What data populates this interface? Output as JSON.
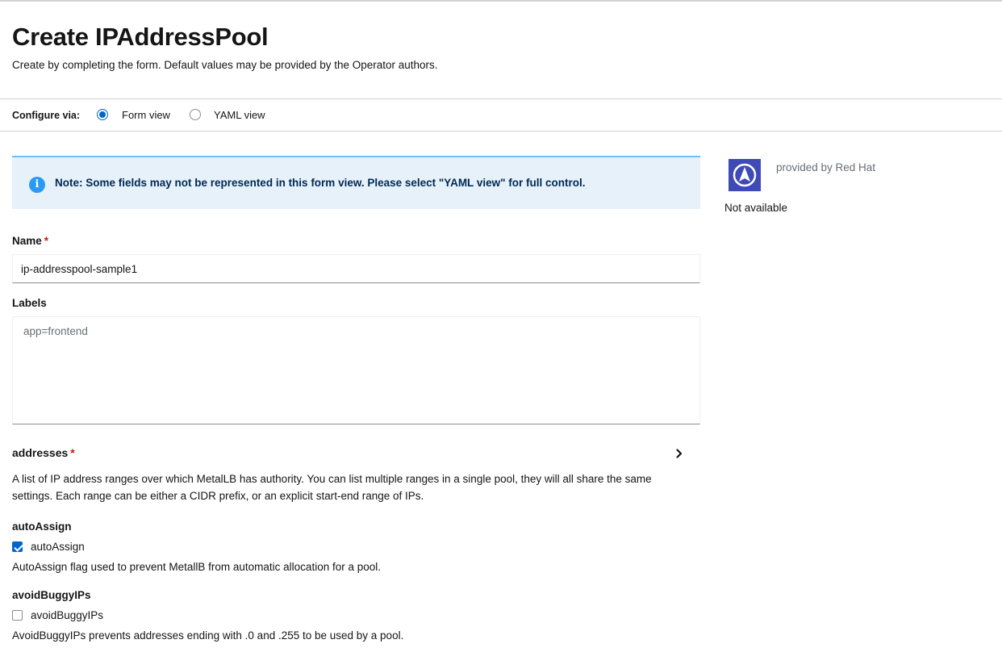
{
  "page": {
    "title": "Create IPAddressPool",
    "subtitle": "Create by completing the form. Default values may be provided by the Operator authors."
  },
  "config": {
    "label": "Configure via:",
    "options": [
      {
        "label": "Form view",
        "selected": true
      },
      {
        "label": "YAML view",
        "selected": false
      }
    ]
  },
  "alert": {
    "text": "Note: Some fields may not be represented in this form view. Please select \"YAML view\" for full control.",
    "icon": "info-circle-icon"
  },
  "form": {
    "name": {
      "label": "Name",
      "required_mark": "*",
      "value": "ip-addresspool-sample1"
    },
    "labels": {
      "label": "Labels",
      "placeholder": "app=frontend"
    },
    "addresses": {
      "label": "addresses",
      "required_mark": "*",
      "description": "A list of IP address ranges over which MetalLB has authority. You can list multiple ranges in a single pool, they will all share the same settings. Each range can be either a CIDR prefix, or an explicit start-end range of IPs."
    },
    "autoAssign": {
      "label": "autoAssign",
      "checkbox_label": "autoAssign",
      "checked": true,
      "description": "AutoAssign flag used to prevent MetallB from automatic allocation for a pool."
    },
    "avoidBuggyIPs": {
      "label": "avoidBuggyIPs",
      "checkbox_label": "avoidBuggyIPs",
      "checked": false,
      "description": "AvoidBuggyIPs prevents addresses ending with .0 and .255 to be used by a pool."
    }
  },
  "provider": {
    "text": "provided by Red Hat",
    "availability": "Not available",
    "logo_color": "#3e4ab6"
  },
  "colors": {
    "accent": "#0066cc",
    "alert_bg": "#e7f1fa",
    "alert_border": "#73bcf7",
    "required": "#c9190b"
  }
}
